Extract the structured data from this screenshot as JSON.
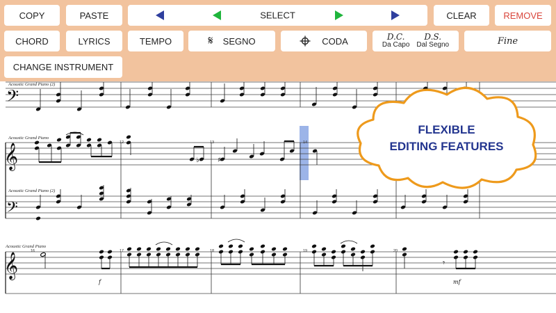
{
  "toolbar": {
    "copy": "COPY",
    "paste": "PASTE",
    "select": "SELECT",
    "clear": "CLEAR",
    "remove": "REMOVE",
    "chord": "CHORD",
    "lyrics": "LYRICS",
    "tempo": "TEMPO",
    "segno": "SEGNO",
    "coda": "CODA",
    "dc_symbol": "D.C.",
    "dc_text": "Da Capo",
    "ds_symbol": "D.S.",
    "ds_text": "Dal Segno",
    "fine": "Fine",
    "change_instrument": "CHANGE INSTRUMENT"
  },
  "colors": {
    "toolbar_bg": "#f2c39e",
    "arrow_blue": "#2f3f9e",
    "arrow_green": "#1fb53c",
    "remove_red": "#d9453b",
    "callout_orange": "#ee9a1c",
    "callout_text": "#23358f",
    "selection_blue": "#7b9be0"
  },
  "callout": {
    "line1": "FLEXIBLE",
    "line2": "EDITING FEATURES"
  },
  "score": {
    "staff_label_1": "Acoustic Grand Piano (2)",
    "staff_label_2": "Acoustic Grand Piano",
    "staff_label_3": "Acoustic Grand Piano (2)",
    "staff_label_4": "Acoustic Grand Piano",
    "measure_12": "12",
    "measure_13": "13",
    "measure_14": "14",
    "measure_16": "16",
    "measure_17": "17",
    "measure_18": "18",
    "measure_19": "19",
    "measure_20": "20",
    "dynamic_f": "f",
    "dynamic_mf": "mf"
  }
}
